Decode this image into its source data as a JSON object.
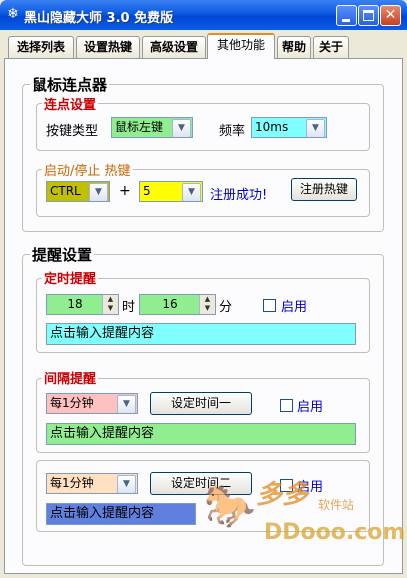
{
  "window": {
    "title": "黑山隐藏大师 3.0 免费版",
    "icon": "snowflake-icon"
  },
  "tabs": [
    {
      "label": "选择列表"
    },
    {
      "label": "设置热键"
    },
    {
      "label": "高级设置"
    },
    {
      "label": "其他功能",
      "active": true
    },
    {
      "label": "帮助"
    },
    {
      "label": "关于"
    }
  ],
  "mouse_clicker": {
    "title": "鼠标连点器",
    "click_settings": {
      "title": "连点设置",
      "key_type_label": "按键类型",
      "key_type_value": "鼠标左键",
      "frequency_label": "频率",
      "frequency_value": "10ms"
    },
    "hotkey": {
      "title": "启动/停止  热键",
      "modifier_value": "CTRL",
      "plus": "+",
      "key_value": "5",
      "status": "注册成功!",
      "register_button": "注册热键"
    }
  },
  "reminder": {
    "title": "提醒设置",
    "timed": {
      "title": "定时提醒",
      "hour": "18",
      "hour_unit": "时",
      "minute": "16",
      "minute_unit": "分",
      "enable_label": "启用",
      "content_placeholder": "点击输入提醒内容"
    },
    "interval1": {
      "title": "间隔提醒",
      "interval_value": "每1分钟",
      "set_button": "设定时间一",
      "enable_label": "启用",
      "content_placeholder": "点击输入提醒内容"
    },
    "interval2": {
      "interval_value": "每1分钟",
      "set_button": "设定时间二",
      "enable_label": "启用",
      "content_placeholder": "点击输入提醒内容"
    }
  },
  "watermark": {
    "line1": "多多",
    "line2": "软件站",
    "line3": "DDooo.com"
  },
  "colors": {
    "title_blue": "#0054e3",
    "cyan": "#80ffff",
    "green": "#90ee90",
    "yellow": "#ffff00",
    "olive": "#c0c000",
    "pink": "#ffc0c0",
    "peach": "#ffe0c0",
    "blue": "#6080e0"
  }
}
